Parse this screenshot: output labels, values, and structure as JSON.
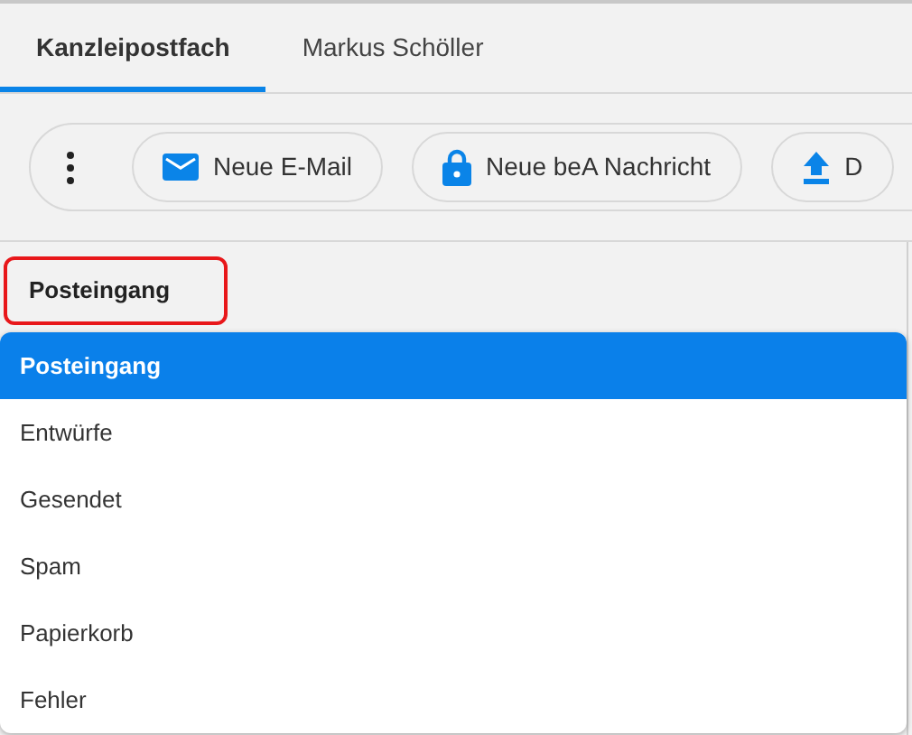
{
  "tabs": [
    {
      "label": "Kanzleipostfach",
      "selected": true
    },
    {
      "label": "Markus Schöller",
      "selected": false
    }
  ],
  "toolbar": {
    "buttons": [
      {
        "kind": "mail",
        "label": "Neue E-Mail"
      },
      {
        "kind": "lock",
        "label": "Neue beA Nachricht"
      },
      {
        "kind": "upload",
        "label": "D"
      }
    ]
  },
  "folder_select": {
    "value": "Posteingang",
    "options": [
      {
        "label": "Posteingang",
        "selected": true
      },
      {
        "label": "Entwürfe",
        "selected": false
      },
      {
        "label": "Gesendet",
        "selected": false
      },
      {
        "label": "Spam",
        "selected": false
      },
      {
        "label": "Papierkorb",
        "selected": false
      },
      {
        "label": "Fehler",
        "selected": false
      }
    ]
  }
}
